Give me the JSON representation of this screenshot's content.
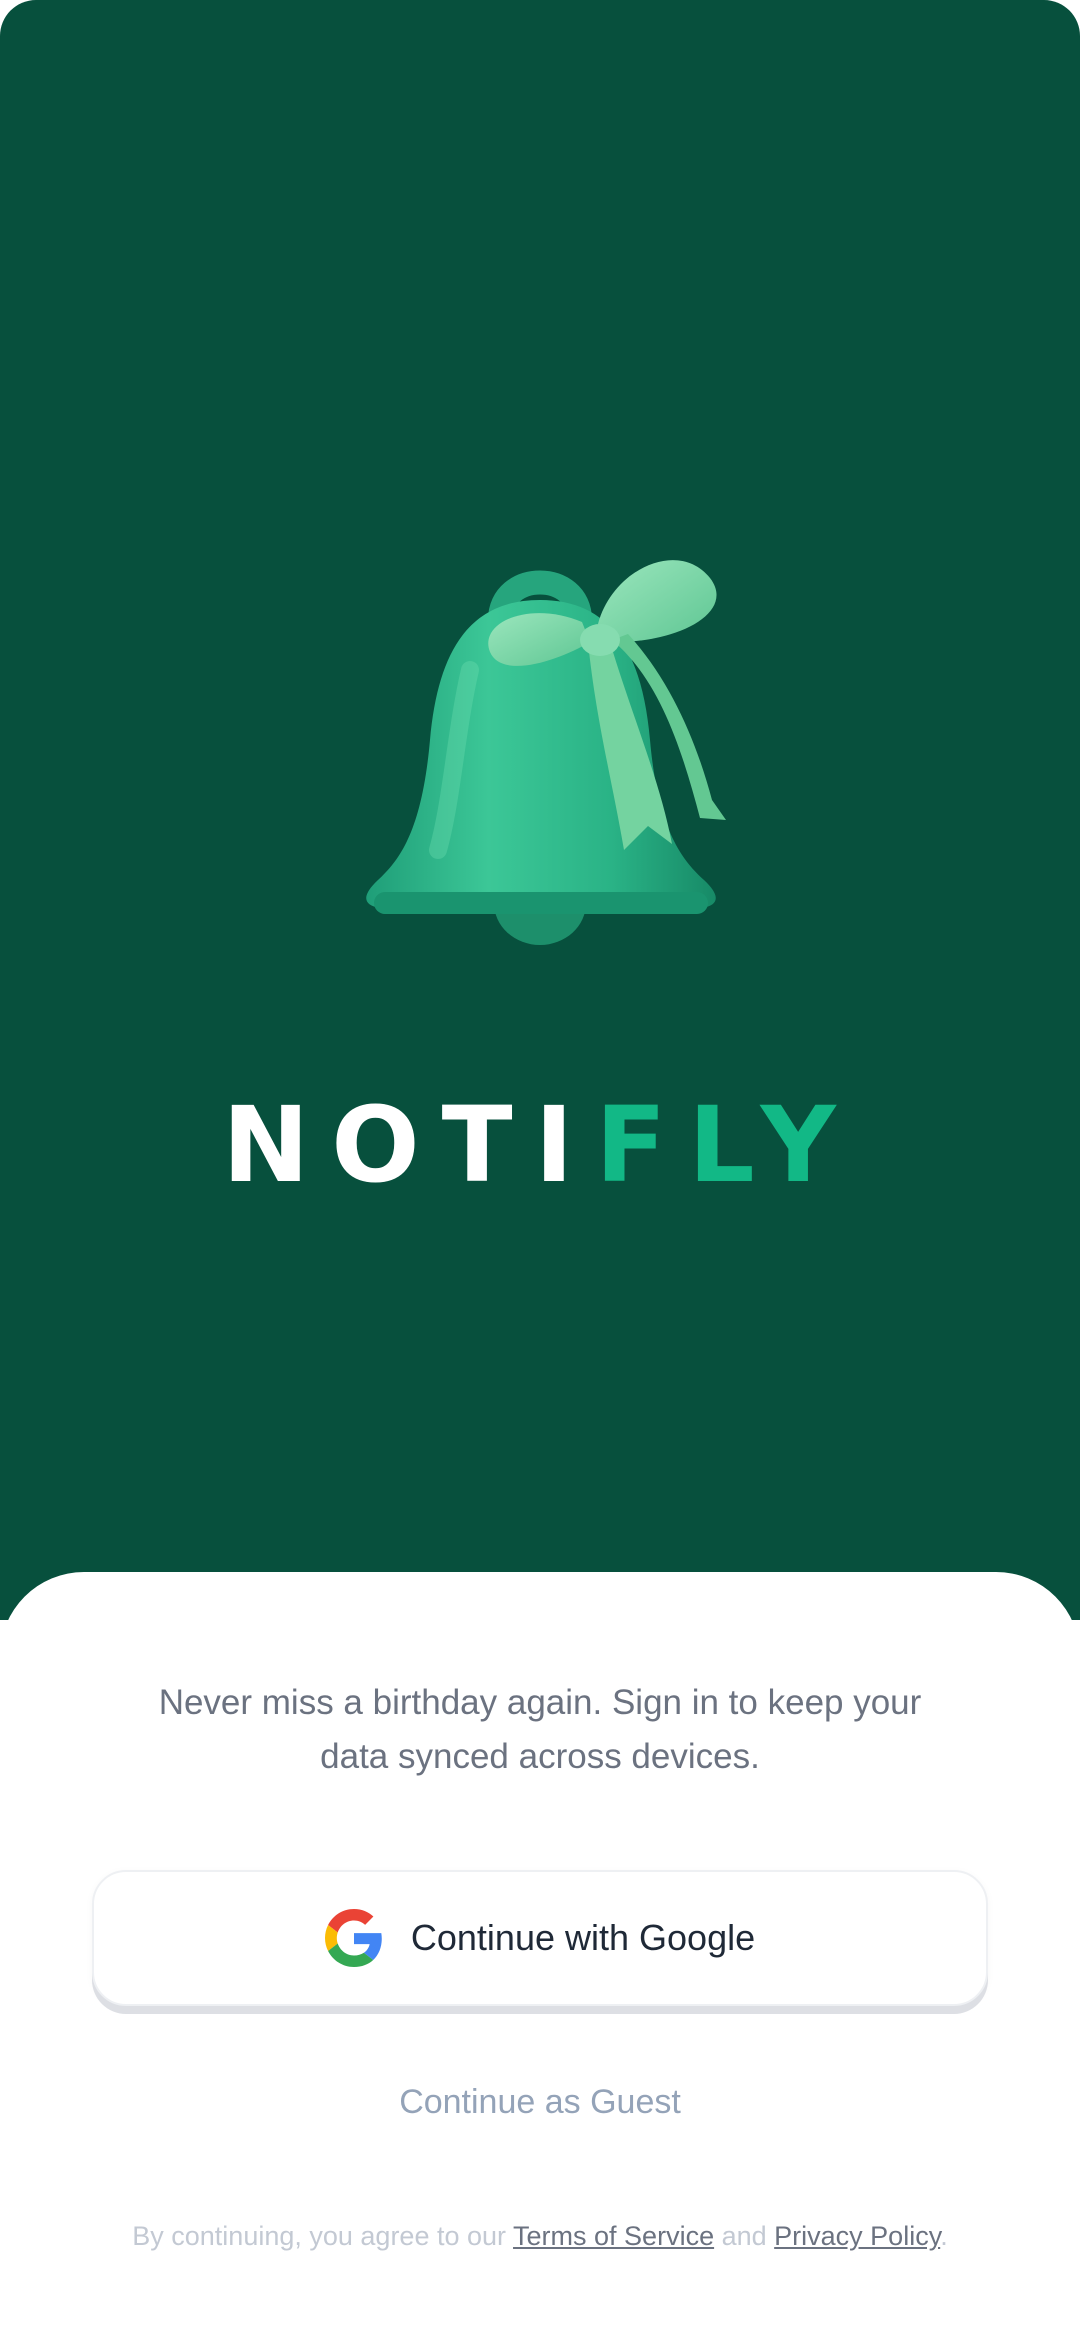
{
  "app": {
    "brand_part1": "NOTI",
    "brand_part2": "FLY"
  },
  "signin": {
    "tagline": "Never miss a birthday again. Sign in to keep your data synced across devices.",
    "google_button_label": "Continue with Google",
    "guest_label": "Continue as Guest"
  },
  "legal": {
    "prefix": "By continuing, you agree to our ",
    "terms_label": "Terms of Service",
    "middle": " and ",
    "privacy_label": "Privacy Policy",
    "suffix": "."
  },
  "icons": {
    "hero": "bell-with-ribbon-icon",
    "google": "google-g-icon"
  },
  "colors": {
    "hero_background": "#07503d",
    "brand_accent": "#12b886",
    "bell": "#2cb58a",
    "ribbon": "#7fd9a8"
  }
}
